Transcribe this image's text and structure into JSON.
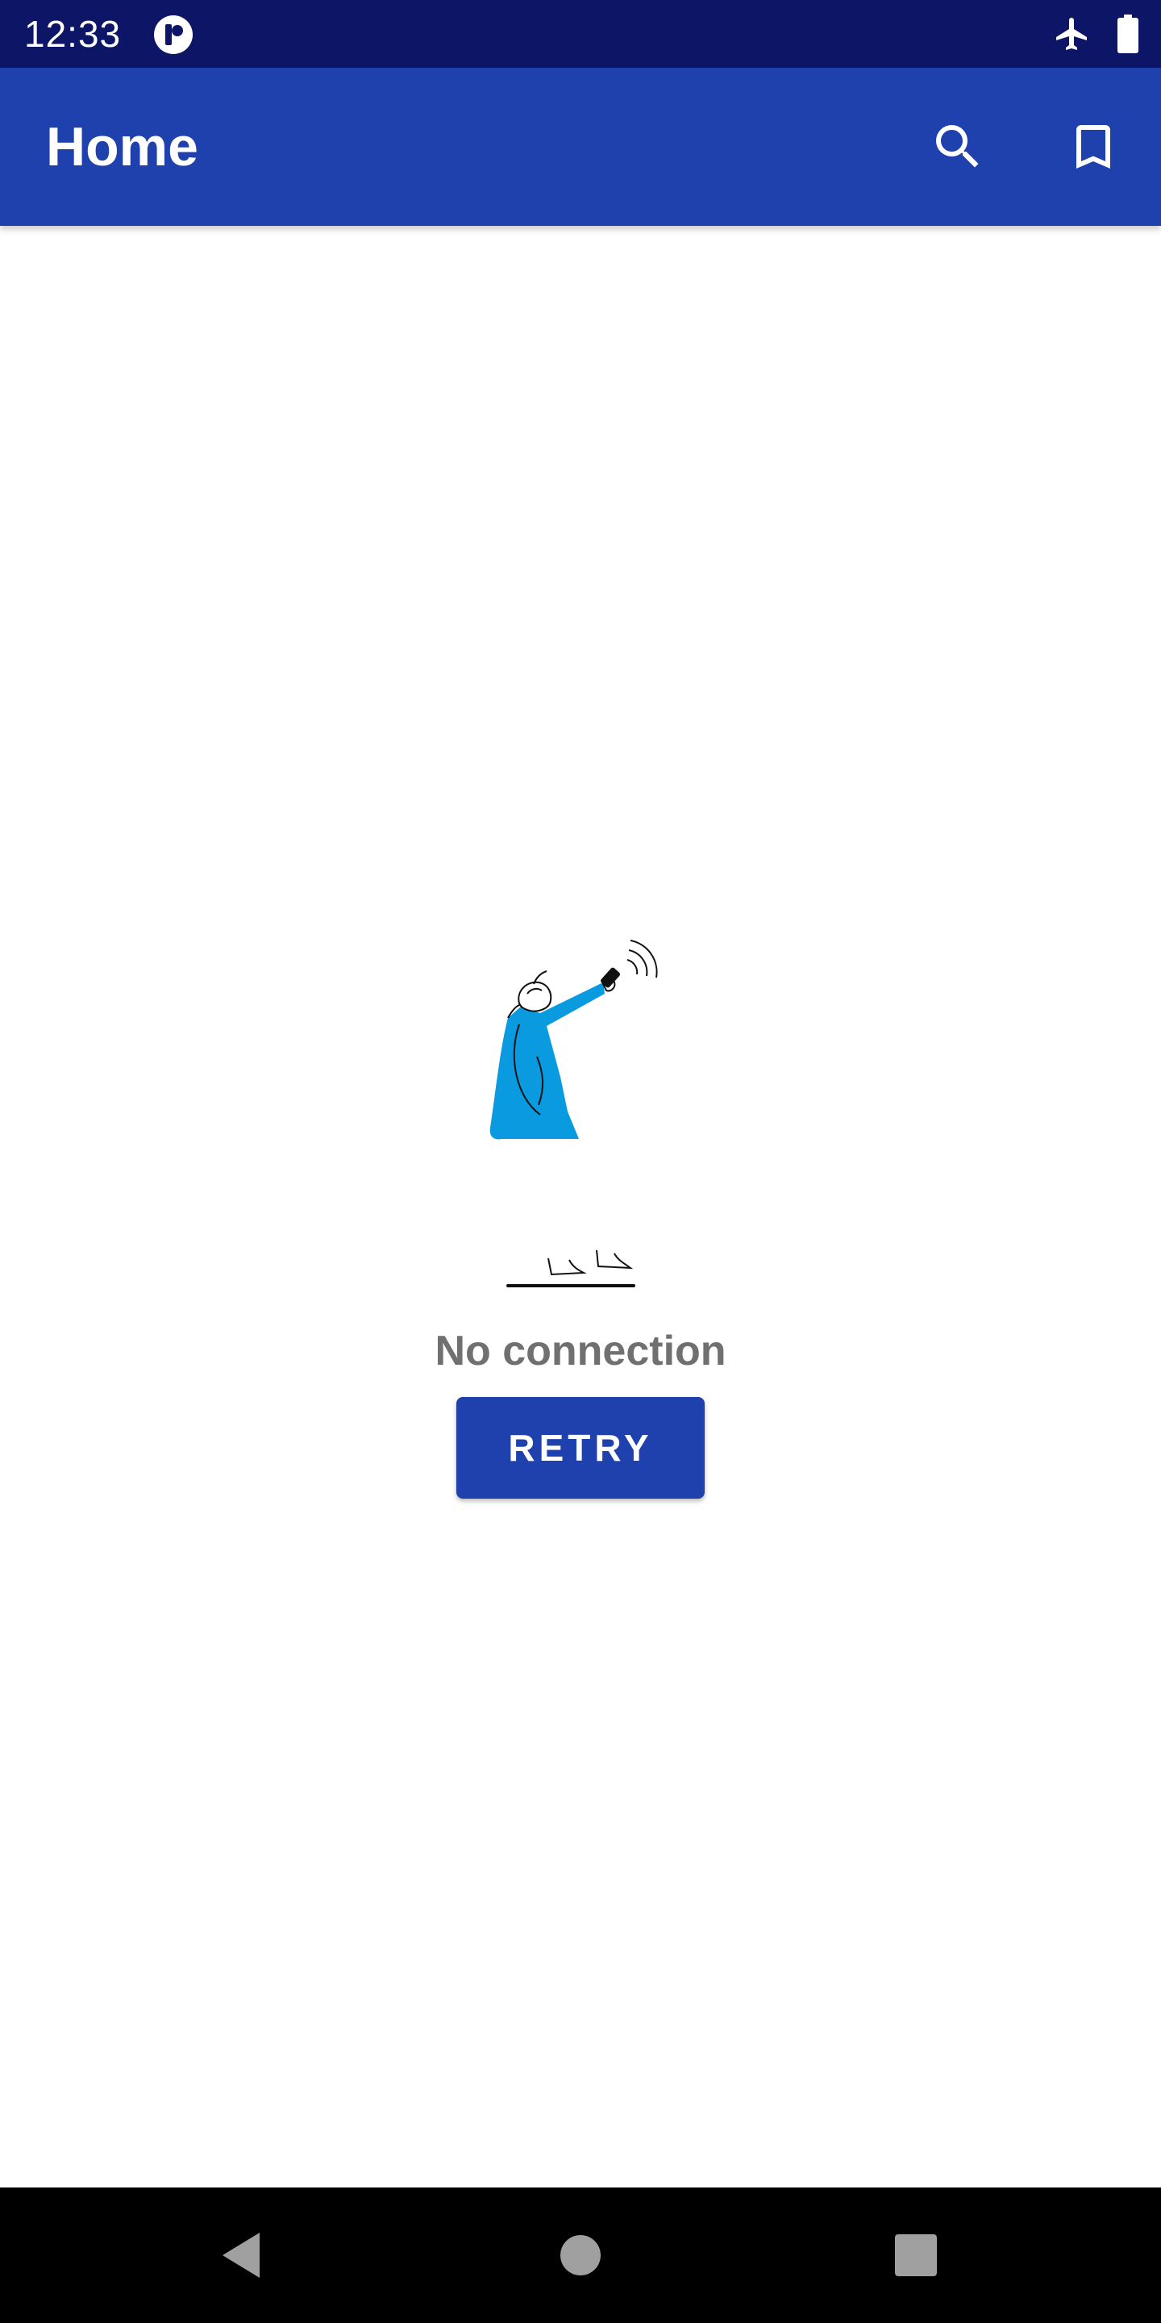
{
  "status_bar": {
    "time": "12:33",
    "icons": [
      "app-notification-icon",
      "airplane-mode-icon",
      "battery-icon"
    ],
    "background": "#0d1567"
  },
  "app_bar": {
    "title": "Home",
    "actions": [
      "search-icon",
      "bookmark-icon"
    ],
    "background": "#1f41ad"
  },
  "empty_state": {
    "illustration": "person-holding-phone-illustration",
    "message": "No connection",
    "retry_label": "RETRY",
    "accent": "#0a9ae0"
  },
  "nav_bar": {
    "buttons": [
      "back-icon",
      "home-icon",
      "recents-icon"
    ],
    "background": "#000000"
  }
}
